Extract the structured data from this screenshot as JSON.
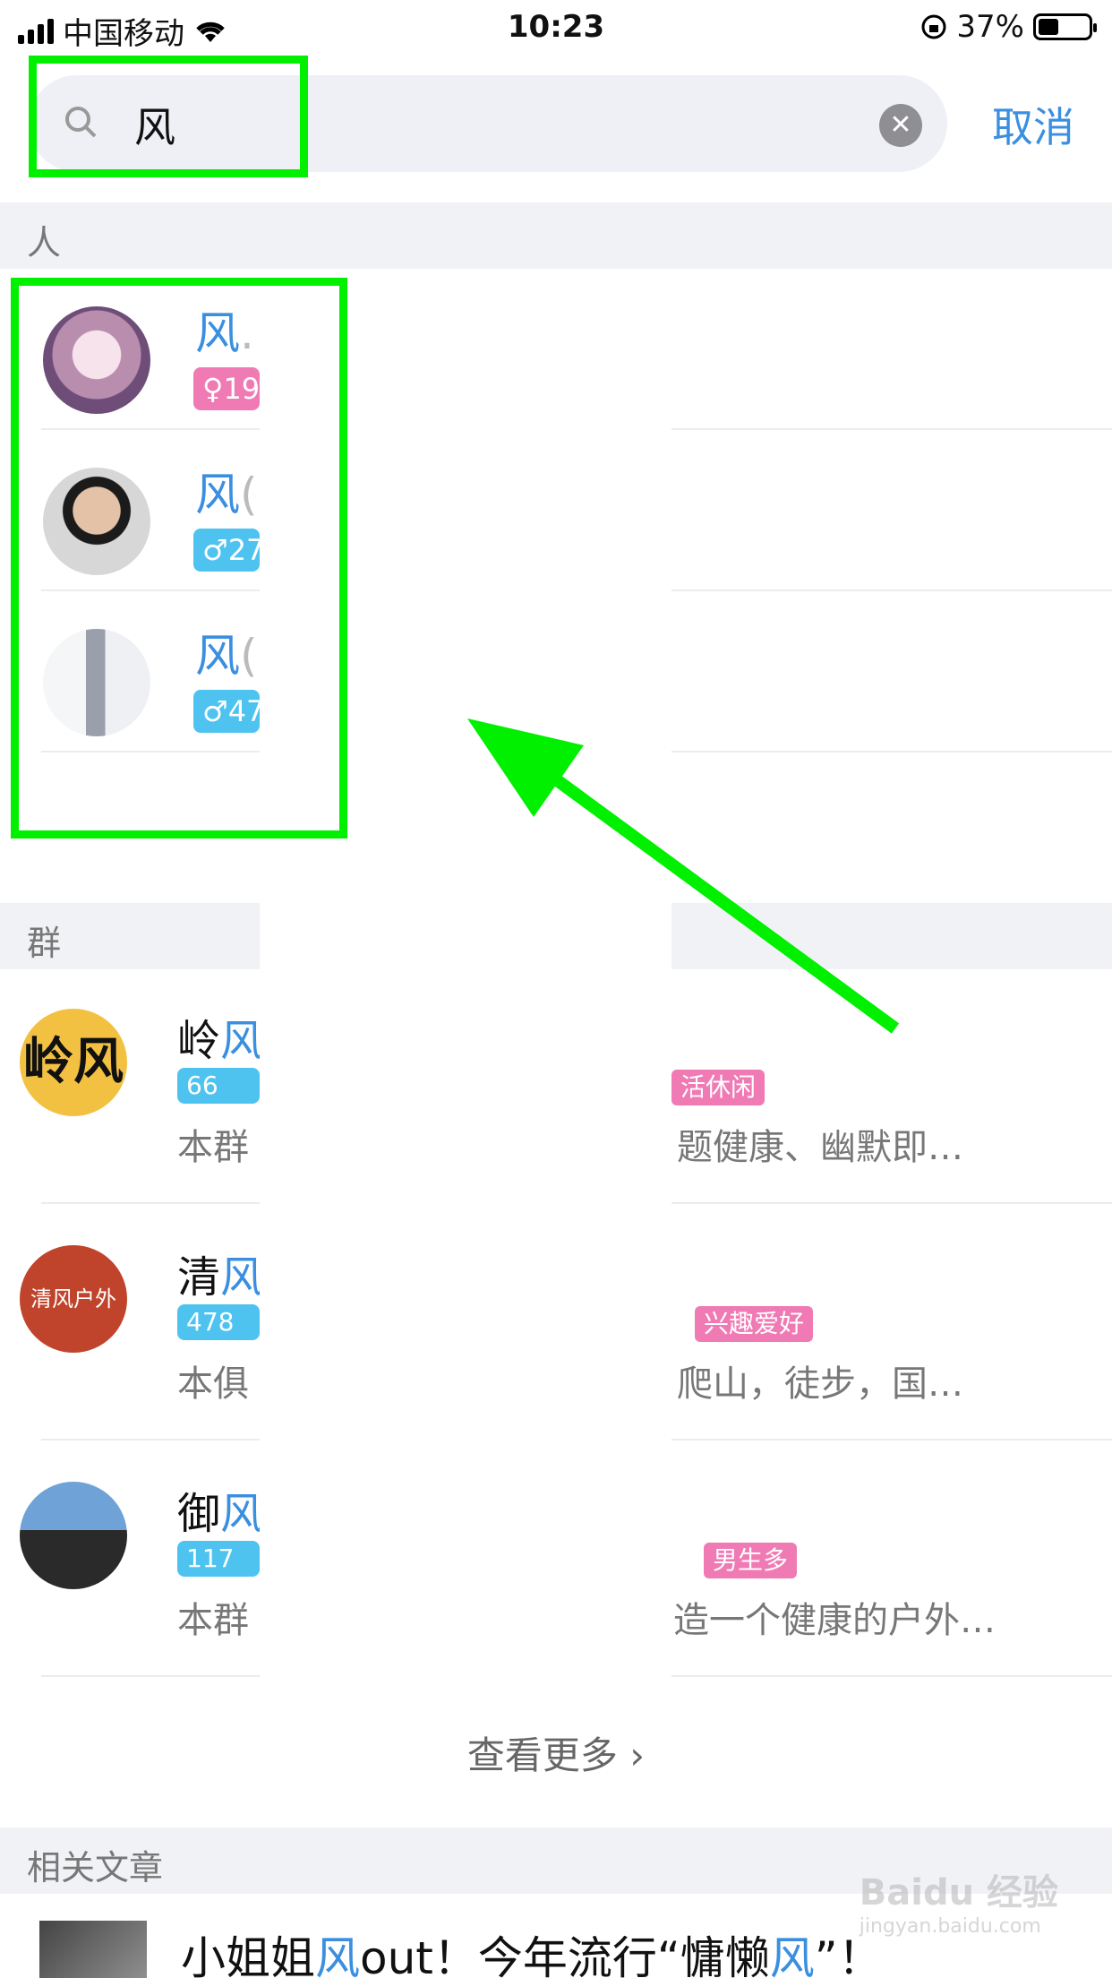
{
  "status_bar": {
    "carrier": "中国移动",
    "time": "10:23",
    "battery": "37%"
  },
  "search": {
    "query": "风",
    "cancel_label": "取消"
  },
  "sections": {
    "people": "人",
    "groups": "群",
    "articles": "相关文章"
  },
  "people": [
    {
      "name": "风",
      "suffix": ".",
      "tag": "♀19",
      "tag_color": "#f07ab4"
    },
    {
      "name": "风",
      "suffix": "(",
      "tag": "♂27",
      "tag_color": "#4ec3f0"
    },
    {
      "name": "风",
      "suffix": "(",
      "tag": "♂47",
      "tag_color": "#4ec3f0"
    }
  ],
  "groups": [
    {
      "name_first": "岭",
      "name_hl": "风",
      "members": "66",
      "desc_left": "本群",
      "desc_right": "题健康、幽默即…",
      "tags_right": [
        "活休闲"
      ],
      "avatar_text": "岭风"
    },
    {
      "name_first": "清",
      "name_hl": "风",
      "members": "478",
      "desc_left": "本俱",
      "desc_right": "爬山，徒步，国…",
      "tags_right": [
        "兴趣爱好"
      ],
      "avatar_text": "清风户外"
    },
    {
      "name_first": "御",
      "name_hl": "风",
      "members": "117",
      "desc_left": "本群",
      "desc_right": "造一个健康的户外…",
      "tags_right": [
        "男生多"
      ],
      "avatar_text": ""
    }
  ],
  "see_more": "查看更多",
  "article": {
    "title_a": "小姐姐",
    "title_hl1": "风",
    "title_b": "out！今年流行“慵懒",
    "title_hl2": "风",
    "title_c": "”！"
  },
  "watermark": {
    "brand": "Baidu 经验",
    "url": "jingyan.baidu.com"
  }
}
